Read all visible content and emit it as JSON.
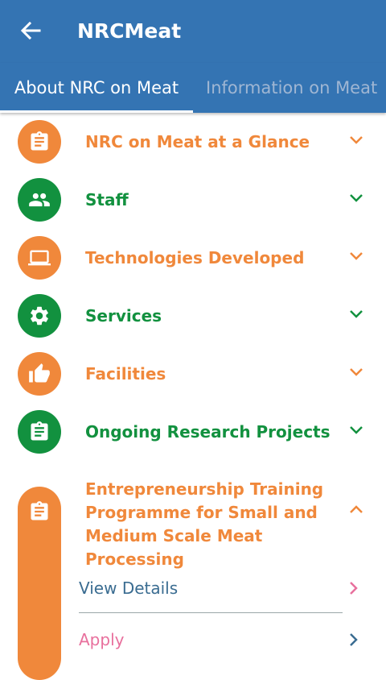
{
  "appbar": {
    "title": "NRCMeat",
    "back_icon": "arrow-back-icon"
  },
  "tabs": [
    {
      "label": "About NRC on Meat",
      "selected": true
    },
    {
      "label": "Information on Meat",
      "selected": false
    }
  ],
  "colors": {
    "primary": "#3474b3",
    "orange": "#f0883b",
    "green": "#12913f",
    "link_blue": "#3a6c91",
    "apply_pink": "#e8709d"
  },
  "sections": [
    {
      "label": "NRC on Meat at a Glance",
      "icon": "clipboard-icon",
      "color": "orange",
      "expanded": false
    },
    {
      "label": "Staff",
      "icon": "people-icon",
      "color": "green",
      "expanded": false
    },
    {
      "label": "Technologies Developed",
      "icon": "laptop-icon",
      "color": "orange",
      "expanded": false
    },
    {
      "label": "Services",
      "icon": "gear-icon",
      "color": "green",
      "expanded": false
    },
    {
      "label": "Facilities",
      "icon": "thumbs-up-icon",
      "color": "orange",
      "expanded": false
    },
    {
      "label": "Ongoing Research Projects",
      "icon": "clipboard-icon",
      "color": "green",
      "expanded": false
    }
  ],
  "expanded_section": {
    "title_lines": [
      "Entrepreneurship Training",
      "Programme for Small and",
      "Medium Scale Meat Processing"
    ],
    "icon": "clipboard-icon",
    "expanded": true,
    "sub_items": [
      {
        "label": "View Details"
      },
      {
        "label": "Apply"
      }
    ]
  }
}
